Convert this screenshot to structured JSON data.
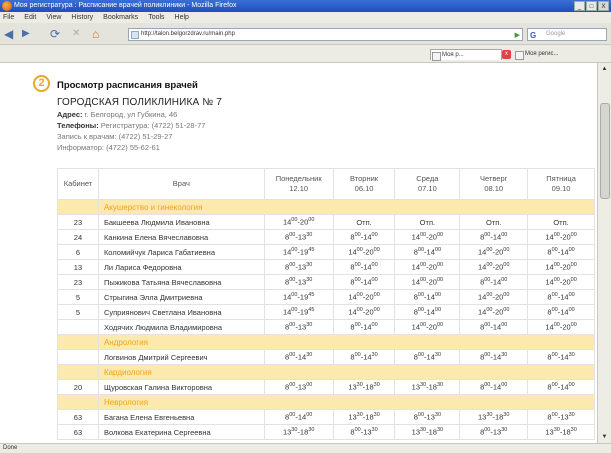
{
  "window": {
    "title": "Моя регистратура : Расписание врачей поликлиники - Mozilla Firefox",
    "min": "_",
    "max": "□",
    "close": "X"
  },
  "menu": [
    "File",
    "Edit",
    "View",
    "History",
    "Bookmarks",
    "Tools",
    "Help"
  ],
  "nav": {
    "url": "http://talon.belgorzdrav.ru/main.php",
    "search_placeholder": "Google",
    "back": "◀",
    "forward": "▶",
    "reload": "⟳",
    "stop": "✕",
    "home": "⌂",
    "go": "▶"
  },
  "tabs": {
    "tab1": "Моя р...",
    "tab2": "Моя регис..."
  },
  "status": "Done",
  "page": {
    "step": "2",
    "heading": "Просмотр расписания врачей",
    "org": "ГОРОДСКАЯ ПОЛИКЛИНИКА № 7",
    "address_label": "Адрес:",
    "address": "г. Белгород, ул Губкина, 46",
    "phones_label": "Телефоны:",
    "phones": "Регистратура: (4722) 51-28-77",
    "appointment": "Запись к врачам: (4722) 51-29-27",
    "info": "Информатор: (4722) 55-62-61"
  },
  "table": {
    "headers": {
      "cab": "Кабинет",
      "doc": "Врач",
      "d1": "Понедельник",
      "d1d": "12.10",
      "d2": "Вторник",
      "d2d": "06.10",
      "d3": "Среда",
      "d3d": "07.10",
      "d4": "Четверг",
      "d4d": "08.10",
      "d5": "Пятница",
      "d5d": "09.10"
    },
    "rows": [
      {
        "section": "Акушерство и гинекология"
      },
      {
        "cab": "23",
        "doc": "Бакшеева Людмила Ивановна",
        "days": [
          "14:00-20:00",
          "Отп.",
          "Отп.",
          "Отп.",
          "Отп."
        ]
      },
      {
        "cab": "24",
        "doc": "Канкина Елена Вячеславовна",
        "days": [
          "8:00-13:30",
          "8:00-14:00",
          "14:00-20:00",
          "8:00-14:00",
          "14:00-20:00"
        ]
      },
      {
        "cab": "6",
        "doc": "Коломийчук Лариса Габатиевна",
        "days": [
          "14:00-19:45",
          "14:00-20:00",
          "8:00-14:00",
          "14:00-20:00",
          "8:00-14:00"
        ]
      },
      {
        "cab": "13",
        "doc": "Ли Лариса Федоровна",
        "days": [
          "8:00-13:30",
          "8:00-14:00",
          "14:00-20:00",
          "14:00-20:00",
          "14:00-20:00"
        ]
      },
      {
        "cab": "23",
        "doc": "Пыжикова Татьяна Вячеславовна",
        "days": [
          "8:00-13:30",
          "8:00-14:00",
          "14:00-20:00",
          "8:00-14:00",
          "14:00-20:00"
        ]
      },
      {
        "cab": "5",
        "doc": "Стрыгина Элла Дмитриевна",
        "days": [
          "14:00-19:45",
          "14:00-20:00",
          "8:00-14:00",
          "14:00-20:00",
          "8:00-14:00"
        ]
      },
      {
        "cab": "5",
        "doc": "Суприянович Светлана Ивановна",
        "days": [
          "14:00-19:45",
          "14:00-20:00",
          "8:00-14:00",
          "14:00-20:00",
          "8:00-14:00"
        ]
      },
      {
        "cab": "",
        "doc": "Ходячих Людмила Владимировна",
        "days": [
          "8:00-13:30",
          "8:00-14:00",
          "14:00-20:00",
          "8:00-14:00",
          "14:00-20:00"
        ]
      },
      {
        "section": "Андрология"
      },
      {
        "cab": "",
        "doc": "Логвинов Дмитрий Сергеевич",
        "days": [
          "8:00-14:30",
          "8:00-14:30",
          "8:00-14:30",
          "8:00-14:30",
          "8:00-14:30"
        ]
      },
      {
        "section": "Кардиология"
      },
      {
        "cab": "20",
        "doc": "Щуровская Галина Викторовна",
        "days": [
          "8:00-13:00",
          "13:30-18:30",
          "13:30-18:30",
          "8:00-14:00",
          "8:00-14:00"
        ]
      },
      {
        "section": "Неврология"
      },
      {
        "cab": "63",
        "doc": "Багана Елена Евгеньевна",
        "days": [
          "8:00-14:00",
          "13:30-18:30",
          "8:00-13:30",
          "13:30-18:30",
          "8:00-13:30"
        ]
      },
      {
        "cab": "63",
        "doc": "Волкова Екатерина Сергеевна",
        "days": [
          "13:30-18:30",
          "8:00-13:30",
          "13:30-18:30",
          "8:00-13:30",
          "13:30-18:30"
        ]
      }
    ]
  }
}
